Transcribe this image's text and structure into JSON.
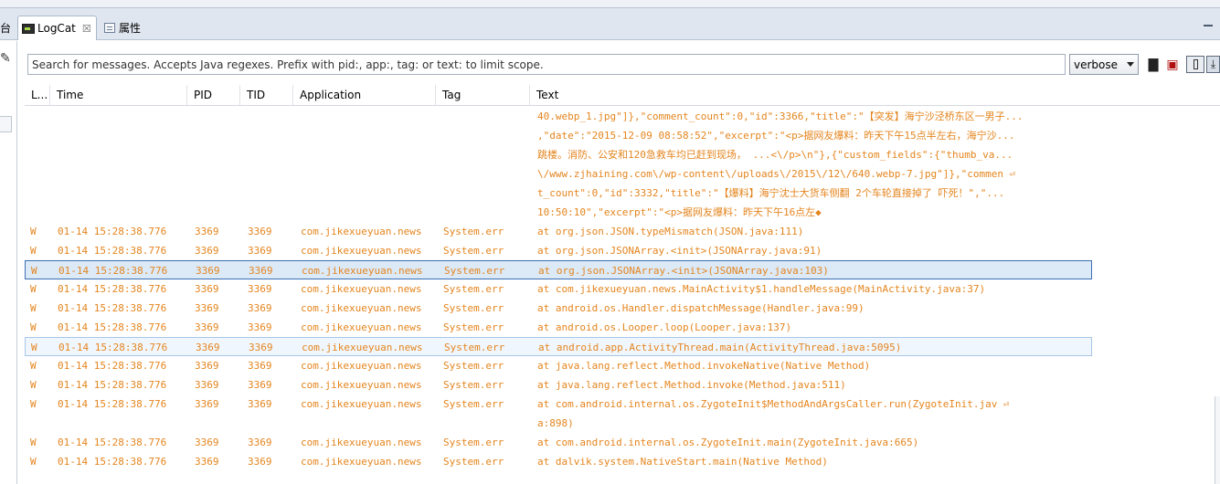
{
  "tabs": {
    "partial_label": "台",
    "logcat_label": "LogCat",
    "logcat_close": "☒",
    "properties_label": "属性"
  },
  "toolbar": {
    "search_placeholder": "Search for messages. Accepts Java regexes. Prefix with pid:, app:, tag: or text: to limit scope.",
    "search_value": "",
    "level_selected": "verbose"
  },
  "columns": [
    "L...",
    "Time",
    "PID",
    "TID",
    "Application",
    "Tag",
    "Text"
  ],
  "colors": {
    "warning_text": "#e4851e",
    "selection_border": "#3c6eb4",
    "tabbar_bg": "#dfe6ef"
  },
  "rows": [
    {
      "level": "",
      "time": "",
      "pid": "",
      "tid": "",
      "app": "",
      "tag": "",
      "text": "40.webp_1.jpg\"]},\"comment_count\":0,\"id\":3366,\"title\":\"【突发】海宁沙泾桥东区一男子..."
    },
    {
      "level": "",
      "time": "",
      "pid": "",
      "tid": "",
      "app": "",
      "tag": "",
      "text": ",\"date\":\"2015-12-09 08:58:52\",\"excerpt\":\"<p>据网友爆料：昨天下午15点半左右，海宁沙..."
    },
    {
      "level": "",
      "time": "",
      "pid": "",
      "tid": "",
      "app": "",
      "tag": "",
      "text": "跳楼。消防、公安和120急救车均已赶到现场，  ...<\\/p>\\n\"},{\"custom_fields\":{\"thumb_va..."
    },
    {
      "level": "",
      "time": "",
      "pid": "",
      "tid": "",
      "app": "",
      "tag": "",
      "text": "\\/www.zjhaining.com\\/wp-content\\/uploads\\/2015\\/12\\/640.webp-7.jpg\"]},\"commen ⏎"
    },
    {
      "level": "",
      "time": "",
      "pid": "",
      "tid": "",
      "app": "",
      "tag": "",
      "text": "t_count\":0,\"id\":3332,\"title\":\"【爆料】海宁沈士大货车侧翻 2个车轮直接掉了 吓死！\",\"..."
    },
    {
      "level": "",
      "time": "",
      "pid": "",
      "tid": "",
      "app": "",
      "tag": "",
      "text": "10:50:10\",\"excerpt\":\"<p>据网友爆料：昨天下午16点左◆"
    },
    {
      "level": "W",
      "time": "01-14 15:28:38.776",
      "pid": "3369",
      "tid": "3369",
      "app": "com.jikexueyuan.news",
      "tag": "System.err",
      "text": "at org.json.JSON.typeMismatch(JSON.java:111)"
    },
    {
      "level": "W",
      "time": "01-14 15:28:38.776",
      "pid": "3369",
      "tid": "3369",
      "app": "com.jikexueyuan.news",
      "tag": "System.err",
      "text": "at org.json.JSONArray.<init>(JSONArray.java:91)"
    },
    {
      "level": "W",
      "time": "01-14 15:28:38.776",
      "pid": "3369",
      "tid": "3369",
      "app": "com.jikexueyuan.news",
      "tag": "System.err",
      "text": "at org.json.JSONArray.<init>(JSONArray.java:103)",
      "state": "selected"
    },
    {
      "level": "W",
      "time": "01-14 15:28:38.776",
      "pid": "3369",
      "tid": "3369",
      "app": "com.jikexueyuan.news",
      "tag": "System.err",
      "text": "at com.jikexueyuan.news.MainActivity$1.handleMessage(MainActivity.java:37)"
    },
    {
      "level": "W",
      "time": "01-14 15:28:38.776",
      "pid": "3369",
      "tid": "3369",
      "app": "com.jikexueyuan.news",
      "tag": "System.err",
      "text": "at android.os.Handler.dispatchMessage(Handler.java:99)"
    },
    {
      "level": "W",
      "time": "01-14 15:28:38.776",
      "pid": "3369",
      "tid": "3369",
      "app": "com.jikexueyuan.news",
      "tag": "System.err",
      "text": "at android.os.Looper.loop(Looper.java:137)"
    },
    {
      "level": "W",
      "time": "01-14 15:28:38.776",
      "pid": "3369",
      "tid": "3369",
      "app": "com.jikexueyuan.news",
      "tag": "System.err",
      "text": "at android.app.ActivityThread.main(ActivityThread.java:5095)",
      "state": "hover"
    },
    {
      "level": "W",
      "time": "01-14 15:28:38.776",
      "pid": "3369",
      "tid": "3369",
      "app": "com.jikexueyuan.news",
      "tag": "System.err",
      "text": "at java.lang.reflect.Method.invokeNative(Native Method)"
    },
    {
      "level": "W",
      "time": "01-14 15:28:38.776",
      "pid": "3369",
      "tid": "3369",
      "app": "com.jikexueyuan.news",
      "tag": "System.err",
      "text": "at java.lang.reflect.Method.invoke(Method.java:511)"
    },
    {
      "level": "W",
      "time": "01-14 15:28:38.776",
      "pid": "3369",
      "tid": "3369",
      "app": "com.jikexueyuan.news",
      "tag": "System.err",
      "text": "at com.android.internal.os.ZygoteInit$MethodAndArgsCaller.run(ZygoteInit.jav ⏎"
    },
    {
      "level": "",
      "time": "",
      "pid": "",
      "tid": "",
      "app": "",
      "tag": "",
      "text": "a:898)"
    },
    {
      "level": "W",
      "time": "01-14 15:28:38.776",
      "pid": "3369",
      "tid": "3369",
      "app": "com.jikexueyuan.news",
      "tag": "System.err",
      "text": "at com.android.internal.os.ZygoteInit.main(ZygoteInit.java:665)"
    },
    {
      "level": "W",
      "time": "01-14 15:28:38.776",
      "pid": "3369",
      "tid": "3369",
      "app": "com.jikexueyuan.news",
      "tag": "System.err",
      "text": "at dalvik.system.NativeStart.main(Native Method)"
    }
  ]
}
